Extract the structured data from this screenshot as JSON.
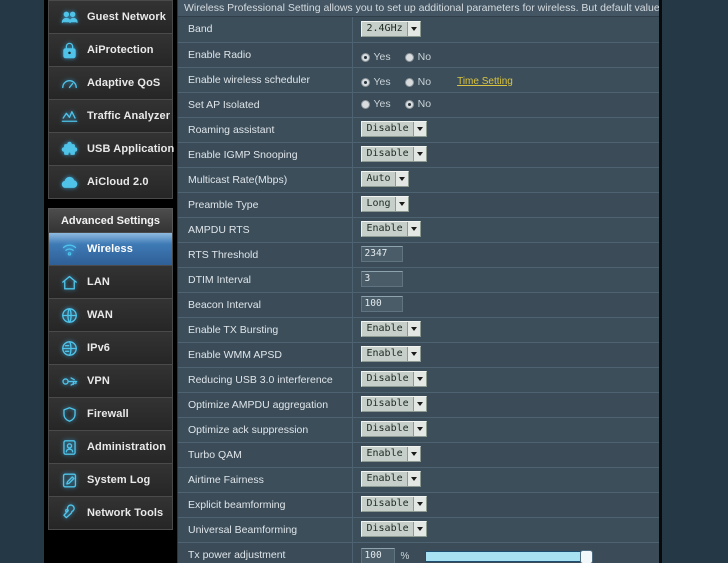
{
  "sidebar": {
    "top_items": [
      {
        "label": "Guest Network",
        "icon": "guest-network-icon"
      },
      {
        "label": "AiProtection",
        "icon": "lock-shield-icon"
      },
      {
        "label": "Adaptive QoS",
        "icon": "gauge-icon"
      },
      {
        "label": "Traffic Analyzer",
        "icon": "chart-line-icon"
      },
      {
        "label": "USB Application",
        "icon": "usb-puzzle-icon"
      },
      {
        "label": "AiCloud 2.0",
        "icon": "cloud-icon"
      }
    ],
    "group_header": "Advanced Settings",
    "advanced_items": [
      {
        "label": "Wireless",
        "icon": "wifi-icon",
        "active": true
      },
      {
        "label": "LAN",
        "icon": "home-icon",
        "active": false
      },
      {
        "label": "WAN",
        "icon": "globe-icon",
        "active": false
      },
      {
        "label": "IPv6",
        "icon": "ipv6-globe-icon",
        "active": false
      },
      {
        "label": "VPN",
        "icon": "vpn-key-icon",
        "active": false
      },
      {
        "label": "Firewall",
        "icon": "shield-icon",
        "active": false
      },
      {
        "label": "Administration",
        "icon": "user-admin-icon",
        "active": false
      },
      {
        "label": "System Log",
        "icon": "log-pencil-icon",
        "active": false
      },
      {
        "label": "Network Tools",
        "icon": "wrench-icon",
        "active": false
      }
    ]
  },
  "main": {
    "description": "Wireless Professional Setting allows you to set up additional parameters for wireless. But default values are recommended.",
    "time_setting_link": "Time Setting",
    "yes_label": "Yes",
    "no_label": "No",
    "percent_symbol": "%",
    "rows": [
      {
        "label": "Band",
        "type": "select",
        "value": "2.4GHz"
      },
      {
        "label": "Enable Radio",
        "type": "radio",
        "value": "Yes"
      },
      {
        "label": "Enable wireless scheduler",
        "type": "radio-link",
        "value": "Yes"
      },
      {
        "label": "Set AP Isolated",
        "type": "radio",
        "value": "No"
      },
      {
        "label": "Roaming assistant",
        "type": "select",
        "value": "Disable"
      },
      {
        "label": "Enable IGMP Snooping",
        "type": "select",
        "value": "Disable"
      },
      {
        "label": "Multicast Rate(Mbps)",
        "type": "select",
        "value": "Auto"
      },
      {
        "label": "Preamble Type",
        "type": "select",
        "value": "Long"
      },
      {
        "label": "AMPDU RTS",
        "type": "select",
        "value": "Enable"
      },
      {
        "label": "RTS Threshold",
        "type": "text",
        "value": "2347"
      },
      {
        "label": "DTIM Interval",
        "type": "text",
        "value": "3"
      },
      {
        "label": "Beacon Interval",
        "type": "text",
        "value": "100"
      },
      {
        "label": "Enable TX Bursting",
        "type": "select",
        "value": "Enable"
      },
      {
        "label": "Enable WMM APSD",
        "type": "select",
        "value": "Enable"
      },
      {
        "label": "Reducing USB 3.0 interference",
        "type": "select",
        "value": "Disable"
      },
      {
        "label": "Optimize AMPDU aggregation",
        "type": "select",
        "value": "Disable"
      },
      {
        "label": "Optimize ack suppression",
        "type": "select",
        "value": "Disable"
      },
      {
        "label": "Turbo QAM",
        "type": "select",
        "value": "Enable"
      },
      {
        "label": "Airtime Fairness",
        "type": "select",
        "value": "Enable"
      },
      {
        "label": "Explicit beamforming",
        "type": "select",
        "value": "Disable"
      },
      {
        "label": "Universal Beamforming",
        "type": "select",
        "value": "Disable"
      },
      {
        "label": "Tx power adjustment",
        "type": "slider",
        "value": "100"
      }
    ]
  },
  "colors": {
    "accent_blue": "#3e7ab5",
    "icon_cyan": "#4fc3e8",
    "link_gold": "#d9c341",
    "panel_bg": "#3b4c58",
    "page_bg": "#253845"
  }
}
